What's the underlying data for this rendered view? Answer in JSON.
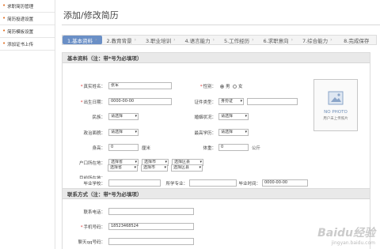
{
  "sidebar": {
    "items": [
      {
        "label": "求职简历管理"
      },
      {
        "label": "简历投递设置"
      },
      {
        "label": "简历模板设置"
      },
      {
        "label": "添加证书上传"
      }
    ]
  },
  "page": {
    "title": "添加/修改简历"
  },
  "steps": [
    {
      "label": "1.基本资料",
      "active": true
    },
    {
      "label": "2.教育背景"
    },
    {
      "label": "3.职业培训"
    },
    {
      "label": "4.语言能力"
    },
    {
      "label": "5.工作经历"
    },
    {
      "label": "6.求职意向"
    },
    {
      "label": "7.综合能力"
    },
    {
      "label": "8.完成保存"
    }
  ],
  "basic": {
    "heading": "基本资料（注：带*号为必填项）",
    "name_label": "真实姓名：",
    "name_value": "张军",
    "gender_label": "性别：",
    "gender_male": "男",
    "gender_female": "女",
    "birth_label": "出生日期：",
    "birth_value": "0000-00-00",
    "idtype_label": "证件类型：",
    "idtype_value": "身份证",
    "nation_label": "民族：",
    "nation_value": "请选择",
    "marital_label": "婚姻状况：",
    "marital_value": "请选择",
    "politics_label": "政治面貌：",
    "politics_value": "请选择",
    "degree_label": "最高学历：",
    "degree_value": "请选择",
    "height_label": "身高：",
    "height_value": "0",
    "height_unit": "厘米",
    "weight_label": "体重：",
    "weight_value": "0",
    "weight_unit": "公斤",
    "hukou_label": "户口所在地：",
    "hukou_province": "选择省",
    "hukou_city": "选择市",
    "hukou_district": "选择区县",
    "current_label": "目前所在地：",
    "current_province": "选择省",
    "current_city": "选择市",
    "current_district": "选择区县",
    "school_label": "毕业学校：",
    "major_label": "所学专业：",
    "gradtime_label": "毕业时间：",
    "gradtime_value": "0000-00-00",
    "photo_text": "NO PHOTO",
    "photo_caption": "用户未上传照片"
  },
  "contact": {
    "heading": "联系方式（注：带*号为必填项）",
    "phone_label": "联系电话：",
    "mobile_label": "手机号码：",
    "mobile_value": "18523468524",
    "qq_label": "聊天qq号码："
  },
  "watermark": {
    "brand": "Baidu经验",
    "url": "jingyan.baidu.com"
  },
  "colors": {
    "active_step": "#6a8fc6",
    "required": "#d33333",
    "sidebar_bullet": "#e06a1b"
  }
}
